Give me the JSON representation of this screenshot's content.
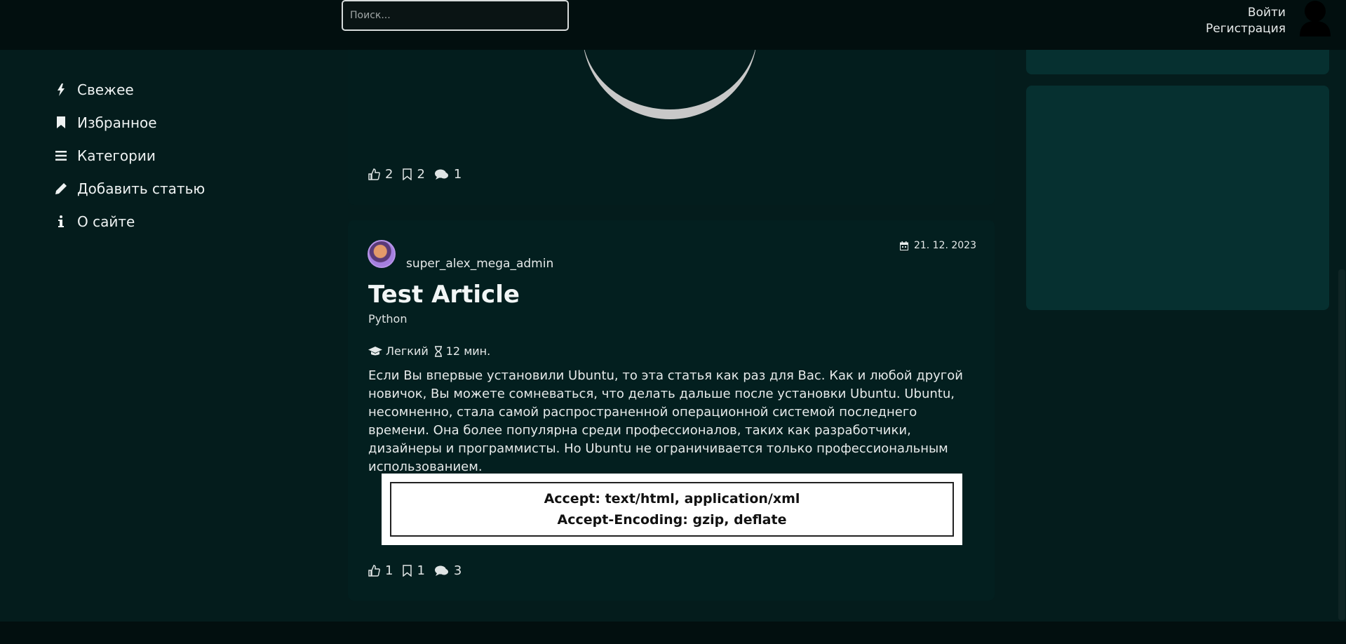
{
  "header": {
    "search_placeholder": "Поиск...",
    "login": "Войти",
    "register": "Регистрация"
  },
  "sidebar": {
    "items": [
      {
        "label": "Свежее",
        "icon": "bolt-icon"
      },
      {
        "label": "Избранное",
        "icon": "bookmark-icon"
      },
      {
        "label": "Категории",
        "icon": "list-icon"
      },
      {
        "label": "Добавить статью",
        "icon": "pencil-icon"
      },
      {
        "label": "О сайте",
        "icon": "info-icon"
      }
    ]
  },
  "post_top": {
    "likes": "2",
    "bookmarks": "2",
    "comments": "1"
  },
  "post_main": {
    "author": "super_alex_mega_admin",
    "date": "21. 12. 2023",
    "title": "Test Article",
    "category": "Python",
    "difficulty": "Легкий",
    "read_time": "12 мин.",
    "excerpt": "Если Вы впервые установили Ubuntu, то эта статья как раз для Вас. Как и любой другой новичок, Вы можете сомневаться, что делать дальше после установки Ubuntu. Ubuntu, несомненно, стала самой распространенной операционной системой последнего времени. Она более популярна среди профессионалов, таких как разработчики, дизайнеры и программисты. Но Ubuntu не ограничивается только профессиональным использованием.",
    "code_line1": "Accept: text/html, application/xml",
    "code_line2": "Accept-Encoding: gzip, deflate",
    "likes": "1",
    "bookmarks": "1",
    "comments": "3"
  }
}
